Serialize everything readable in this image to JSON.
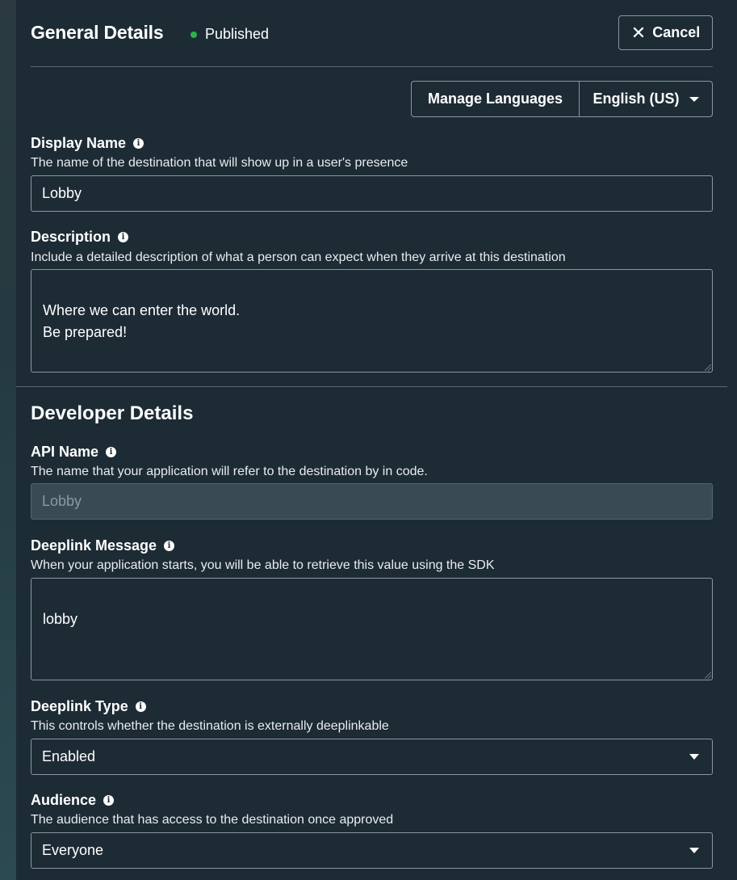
{
  "header": {
    "title": "General Details",
    "status": "Published",
    "status_color": "#2bb34a",
    "cancel_label": "Cancel",
    "cancel_icon": "close-icon"
  },
  "languages": {
    "manage_label": "Manage Languages",
    "selected_language": "English (US)"
  },
  "general": {
    "display_name": {
      "label": "Display Name",
      "help": "The name of the destination that will show up in a user's presence",
      "value": "Lobby"
    },
    "description": {
      "label": "Description",
      "help": "Include a detailed description of what a person can expect when they arrive at this destination",
      "value": "Where we can enter the world.\nBe prepared!"
    }
  },
  "developer": {
    "title": "Developer Details",
    "api_name": {
      "label": "API Name",
      "help": "The name that your application will refer to the destination by in code.",
      "value": "Lobby"
    },
    "deeplink_message": {
      "label": "Deeplink Message",
      "help": "When your application starts, you will be able to retrieve this value using the SDK",
      "value": "lobby"
    },
    "deeplink_type": {
      "label": "Deeplink Type",
      "help": "This controls whether the destination is externally deeplinkable",
      "value": "Enabled"
    },
    "audience": {
      "label": "Audience",
      "help": "The audience that has access to the destination once approved",
      "value": "Everyone"
    }
  },
  "info_icon_glyph": "i"
}
